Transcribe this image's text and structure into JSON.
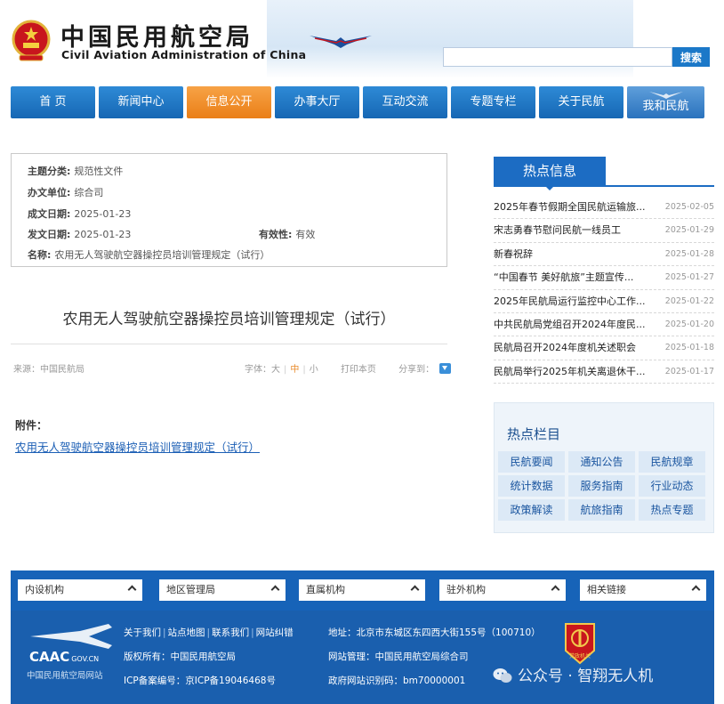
{
  "header": {
    "title_cn": "中国民用航空局",
    "title_en": "Civil Aviation Administration of China",
    "search_placeholder": "",
    "search_button": "搜索"
  },
  "nav": {
    "items": [
      {
        "label": "首 页"
      },
      {
        "label": "新闻中心"
      },
      {
        "label": "信息公开",
        "active": true
      },
      {
        "label": "办事大厅"
      },
      {
        "label": "互动交流"
      },
      {
        "label": "专题专栏"
      },
      {
        "label": "关于民航"
      },
      {
        "label": "我和民航"
      }
    ]
  },
  "meta": {
    "topic_label": "主题分类:",
    "topic": "规范性文件",
    "unit_label": "办文单位:",
    "unit": "综合司",
    "created_label": "成文日期:",
    "created": "2025-01-23",
    "issued_label": "发文日期:",
    "issued": "2025-01-23",
    "validity_label": "有效性:",
    "validity": "有效",
    "name_label": "名称:",
    "name": "农用无人驾驶航空器操控员培训管理规定（试行）"
  },
  "article": {
    "title": "农用无人驾驶航空器操控员培训管理规定（试行）",
    "source": "来源：中国民航局",
    "font_label": "字体：",
    "font_large": "大",
    "font_medium": "中",
    "font_small": "小",
    "print": "打印本页",
    "share": "分享到：",
    "attachment_label": "附件：",
    "attachment_link": "农用无人驾驶航空器操控员培训管理规定（试行）"
  },
  "hot_info": {
    "title": "热点信息",
    "items": [
      {
        "title": "2025年春节假期全国民航运输旅...",
        "date": "2025-02-05"
      },
      {
        "title": "宋志勇春节慰问民航一线员工",
        "date": "2025-01-29"
      },
      {
        "title": "新春祝辞",
        "date": "2025-01-28"
      },
      {
        "title": "“中国春节 美好航旅”主题宣传...",
        "date": "2025-01-27"
      },
      {
        "title": "2025年民航局运行监控中心工作...",
        "date": "2025-01-22"
      },
      {
        "title": "中共民航局党组召开2024年度民...",
        "date": "2025-01-20"
      },
      {
        "title": "民航局召开2024年度机关述职会",
        "date": "2025-01-18"
      },
      {
        "title": "民航局举行2025年机关离退休干...",
        "date": "2025-01-17"
      }
    ]
  },
  "hot_columns": {
    "title": "热点栏目",
    "items": [
      "民航要闻",
      "通知公告",
      "民航规章",
      "统计数据",
      "服务指南",
      "行业动态",
      "政策解读",
      "航旅指南",
      "热点专题"
    ]
  },
  "footer": {
    "selects": [
      "内设机构",
      "地区管理局",
      "直属机构",
      "驻外机构",
      "相关链接"
    ],
    "logo_text": "CAAC",
    "logo_domain": "GOV.CN",
    "logo_sub": "中国民用航空局网站",
    "links": [
      "关于我们",
      "站点地图",
      "联系我们",
      "网站纠错"
    ],
    "copyright": "版权所有：中国民用航空局",
    "icp": "ICP备案编号：京ICP备19046468号",
    "address": "地址：北京市东城区东四西大街155号（100710）",
    "management": "网站管理：中国民用航空局综合司",
    "site_id": "政府网站识别码：bm70000001",
    "badge_text": "党政机关",
    "watermark": "公众号 · 智翔无人机"
  },
  "colors": {
    "nav_blue": "#1b6fc0",
    "nav_active": "#ef8a22",
    "footer_blue": "#1763b8",
    "link_blue": "#1c5fb5"
  }
}
